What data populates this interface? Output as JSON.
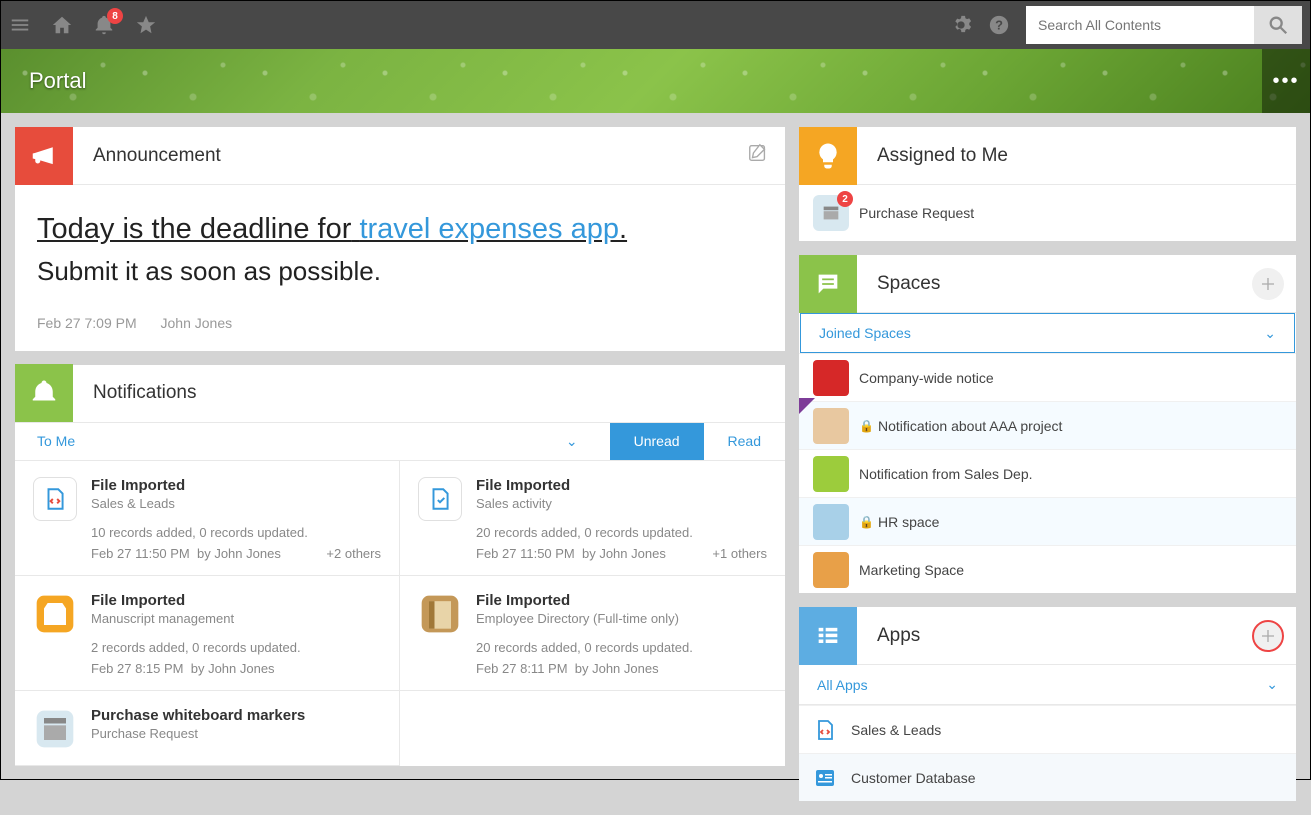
{
  "topbar": {
    "notification_badge": "8",
    "search_placeholder": "Search All Contents"
  },
  "banner": {
    "title": "Portal"
  },
  "announcement": {
    "title": "Announcement",
    "headline_prefix": "Today is the deadline for",
    "headline_link": "travel expenses app",
    "headline_suffix": ".",
    "subline": "Submit it as soon as possible.",
    "date": "Feb 27 7:09 PM",
    "author": "John Jones"
  },
  "notifications": {
    "title": "Notifications",
    "filter_label": "To Me",
    "tab_unread": "Unread",
    "tab_read": "Read",
    "items": [
      {
        "title": "File Imported",
        "app": "Sales & Leads",
        "desc": "10 records added, 0 records updated.",
        "date": "Feb 27 11:50 PM",
        "by": "by John Jones",
        "others": "+2 others",
        "icon_bg": "#ffffff",
        "icon_border": "#3498db"
      },
      {
        "title": "File Imported",
        "app": "Sales activity",
        "desc": "20 records added, 0 records updated.",
        "date": "Feb 27 11:50 PM",
        "by": "by John Jones",
        "others": "+1 others",
        "icon_bg": "#ffffff",
        "icon_border": "#3498db"
      },
      {
        "title": "File Imported",
        "app": "Manuscript management",
        "desc": "2 records added, 0 records updated.",
        "date": "Feb 27 8:15 PM",
        "by": "by John Jones",
        "others": "",
        "icon_bg": "#f5a623"
      },
      {
        "title": "File Imported",
        "app": "Employee Directory (Full-time only)",
        "desc": "20 records added, 0 records updated.",
        "date": "Feb 27 8:11 PM",
        "by": "by John Jones",
        "others": "",
        "icon_bg": "#d4a468"
      },
      {
        "title": "Purchase whiteboard markers",
        "app": "Purchase Request",
        "desc": "",
        "date": "",
        "by": "",
        "others": "",
        "icon_bg": "#d8e8f0"
      }
    ]
  },
  "assigned": {
    "title": "Assigned to Me",
    "items": [
      {
        "label": "Purchase Request",
        "badge": "2"
      }
    ]
  },
  "spaces": {
    "title": "Spaces",
    "filter": "Joined Spaces",
    "items": [
      {
        "label": "Company-wide notice",
        "locked": false,
        "thumb": "#d62828",
        "alt": false,
        "flag": false
      },
      {
        "label": "Notification about AAA project",
        "locked": true,
        "thumb": "#e8c8a0",
        "alt": true,
        "flag": true
      },
      {
        "label": "Notification from Sales Dep.",
        "locked": false,
        "thumb": "#9ccc3c",
        "alt": false,
        "flag": false
      },
      {
        "label": "HR space",
        "locked": true,
        "thumb": "#a8d0e8",
        "alt": true,
        "flag": false
      },
      {
        "label": "Marketing Space",
        "locked": false,
        "thumb": "#e8a048",
        "alt": false,
        "flag": false
      }
    ]
  },
  "apps": {
    "title": "Apps",
    "filter": "All Apps",
    "items": [
      {
        "label": "Sales & Leads",
        "alt": false
      },
      {
        "label": "Customer Database",
        "alt": true
      }
    ]
  }
}
